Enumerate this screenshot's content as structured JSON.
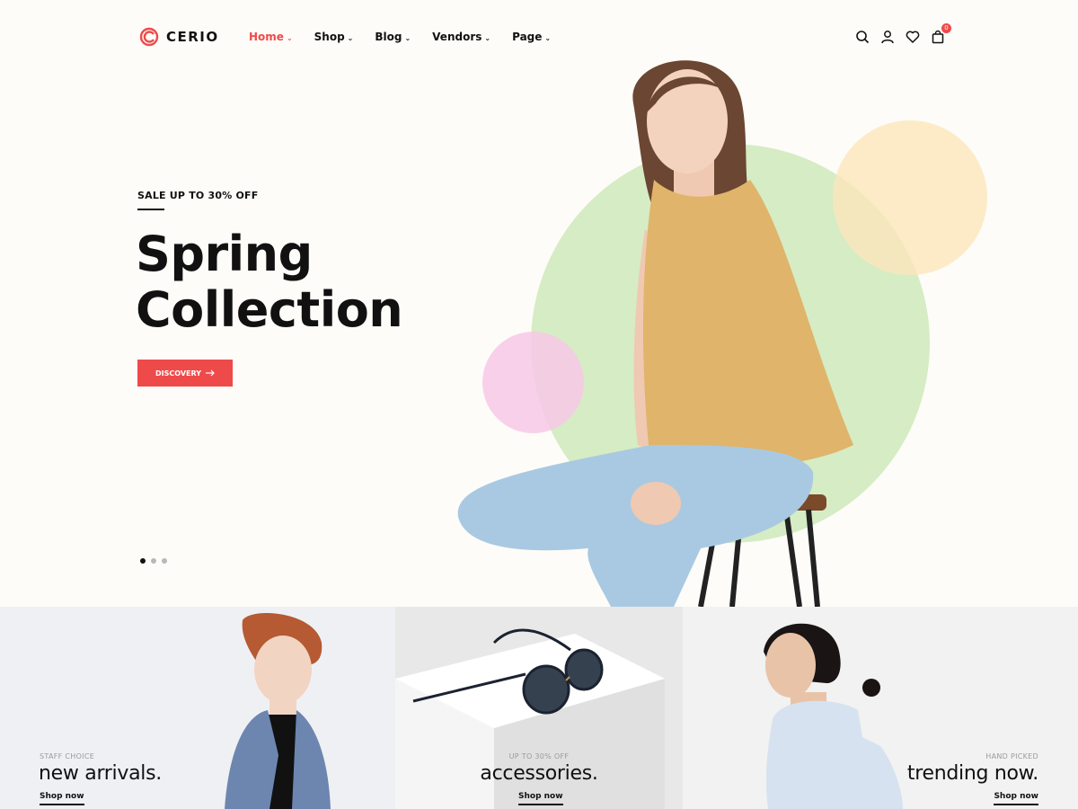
{
  "brand": {
    "name": "CERIO",
    "accent": "#ef4a4a"
  },
  "nav": {
    "items": [
      {
        "label": "Home",
        "active": true
      },
      {
        "label": "Shop",
        "active": false
      },
      {
        "label": "Blog",
        "active": false
      },
      {
        "label": "Vendors",
        "active": false
      },
      {
        "label": "Page",
        "active": false
      }
    ]
  },
  "header_icons": {
    "search": "search-icon",
    "account": "user-icon",
    "wishlist": "heart-icon",
    "cart": "shopping-bag-icon",
    "cart_count": "0"
  },
  "hero": {
    "tag": "SALE UP TO 30% OFF",
    "title_line1": "Spring",
    "title_line2": "Collection",
    "cta_label": "DISCOVERY",
    "cta_icon": "arrow-right-icon",
    "slides": 3,
    "active_slide": 1
  },
  "banners": [
    {
      "subtitle": "STAFF CHOICE",
      "title": "new arrivals.",
      "link": "Shop now"
    },
    {
      "subtitle": "UP TO 30% OFF",
      "title": "accessories.",
      "link": "Shop now"
    },
    {
      "subtitle": "HAND PICKED",
      "title": "trending now.",
      "link": "Shop now"
    }
  ],
  "colors": {
    "circle_green": "#d6ecc4",
    "circle_yellow": "#fde6bb",
    "circle_pink": "#f8c8e8"
  }
}
